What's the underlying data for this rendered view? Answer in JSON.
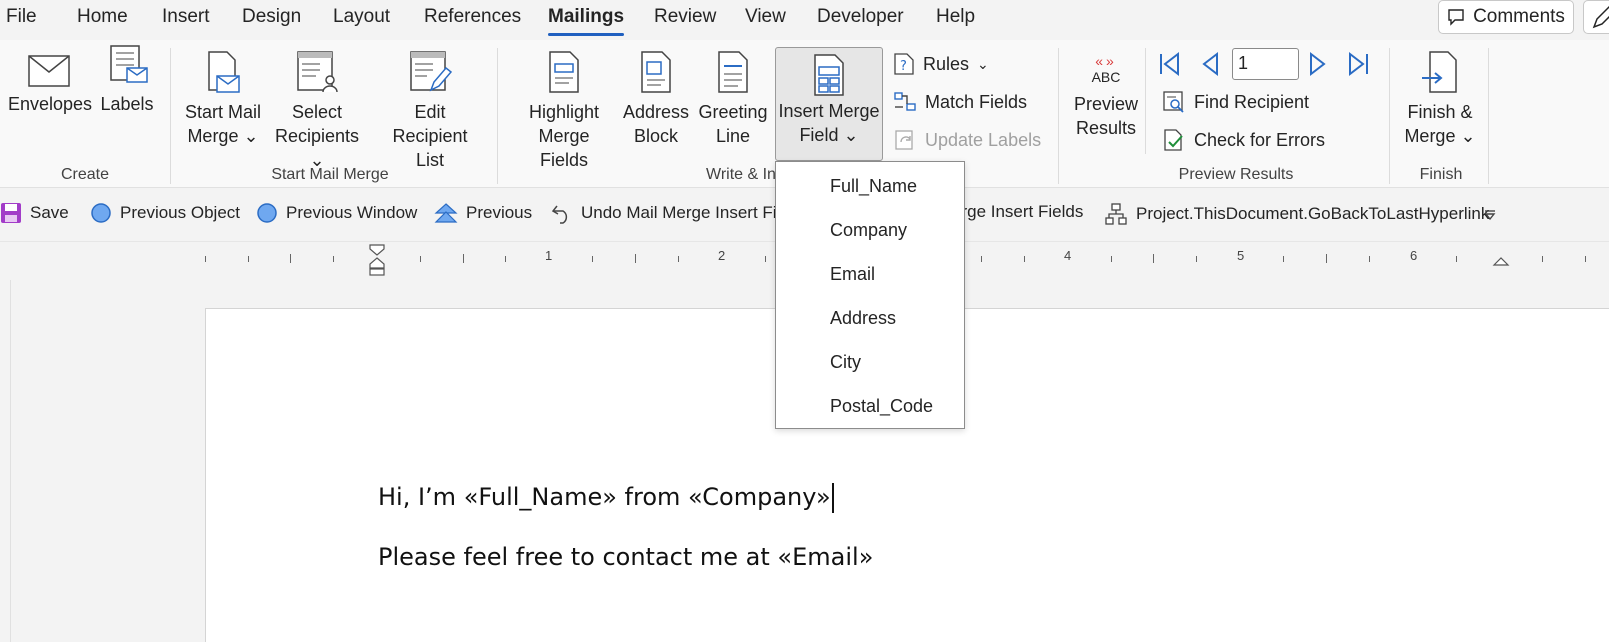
{
  "menu": {
    "tabs": [
      "File",
      "Home",
      "Insert",
      "Design",
      "Layout",
      "References",
      "Mailings",
      "Review",
      "View",
      "Developer",
      "Help"
    ],
    "active_tab": "Mailings",
    "comments_label": "Comments"
  },
  "ribbon": {
    "create": {
      "envelopes": "Envelopes",
      "labels": "Labels",
      "group_label": "Create"
    },
    "start_mail_merge": {
      "start_line1": "Start Mail",
      "start_line2": "Merge",
      "select_line1": "Select",
      "select_line2": "Recipients",
      "edit_line1": "Edit",
      "edit_line2": "Recipient List",
      "group_label": "Start Mail Merge"
    },
    "write_insert": {
      "highlight_line1": "Highlight",
      "highlight_line2": "Merge Fields",
      "address_line1": "Address",
      "address_line2": "Block",
      "greeting_line1": "Greeting",
      "greeting_line2": "Line",
      "insert_line1": "Insert Merge",
      "insert_line2": "Field",
      "rules": "Rules",
      "match_fields": "Match Fields",
      "update_labels": "Update Labels",
      "group_label": "Write & In"
    },
    "preview": {
      "preview_line1": "Preview",
      "preview_line2": "Results",
      "abc": "ABC",
      "record_number": "1",
      "find_recipient": "Find Recipient",
      "check_errors": "Check for Errors",
      "group_label": "Preview Results"
    },
    "finish": {
      "finish_line1": "Finish &",
      "finish_line2": "Merge",
      "group_label": "Finish"
    }
  },
  "quick_access": {
    "save": "Save",
    "previous_object": "Previous Object",
    "previous_window": "Previous Window",
    "previous": "Previous",
    "undo_merge": "Undo Mail Merge Insert Fiel",
    "merge_insert_fields": "erge Insert Fields",
    "go_back_hyperlink": "Project.ThisDocument.GoBackToLastHyperlink"
  },
  "ruler": {
    "numbers": [
      "1",
      "2",
      "4",
      "5",
      "6"
    ]
  },
  "dropdown": {
    "items": [
      "Full_Name",
      "Company",
      "Email",
      "Address",
      "City",
      "Postal_Code"
    ]
  },
  "document": {
    "line1": "Hi, I’m «Full_Name» from «Company»",
    "line2": "Please feel free to contact me at «Email»"
  },
  "colors": {
    "accent": "#1f5fbf",
    "icon_blue": "#2b6cc4",
    "save_purple": "#a23cc8",
    "preview_red": "#d83b3b"
  }
}
